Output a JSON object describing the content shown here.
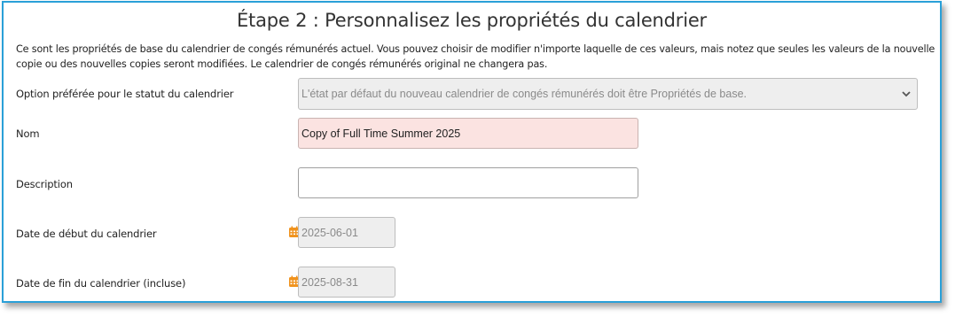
{
  "page": {
    "title": "Étape 2 : Personnalisez les propriétés du calendrier",
    "intro": "Ce sont les propriétés de base du calendrier de congés rémunérés actuel. Vous pouvez choisir de modifier n'importe laquelle de ces valeurs, mais notez que seules les valeurs de la nouvelle copie ou des nouvelles copies seront modifiées. Le calendrier de congés rémunérés original ne changera pas."
  },
  "form": {
    "status_option": {
      "label": "Option préférée pour le statut du calendrier",
      "value": "L'état par défaut du nouveau calendrier de congés rémunérés doit être Propriétés de base."
    },
    "name": {
      "label": "Nom",
      "value": "Copy of Full Time Summer 2025"
    },
    "description": {
      "label": "Description",
      "value": ""
    },
    "start_date": {
      "label": "Date de début du calendrier",
      "value": "2025-06-01"
    },
    "end_date": {
      "label": "Date de fin du calendrier (incluse)",
      "value": "2025-08-31"
    }
  },
  "colors": {
    "frame_border": "#2aa0d8",
    "name_field_bg": "#fbe3e1",
    "calendar_icon": "#f0931e"
  },
  "icons": {
    "select": "chevron-down-icon",
    "date": "calendar-icon"
  }
}
